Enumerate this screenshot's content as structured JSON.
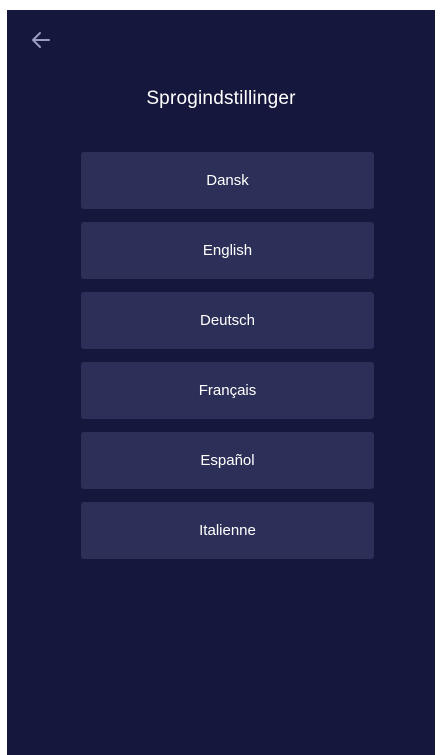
{
  "header": {
    "back_icon": "arrow-left-icon",
    "title": "Sprogindstillinger"
  },
  "colors": {
    "background": "#16173d",
    "button": "#2c2f57",
    "text": "#ffffff",
    "icon": "#9a9cc4"
  },
  "languages": [
    {
      "label": "Dansk"
    },
    {
      "label": "English"
    },
    {
      "label": "Deutsch"
    },
    {
      "label": "Français"
    },
    {
      "label": "Español"
    },
    {
      "label": "Italienne"
    }
  ]
}
